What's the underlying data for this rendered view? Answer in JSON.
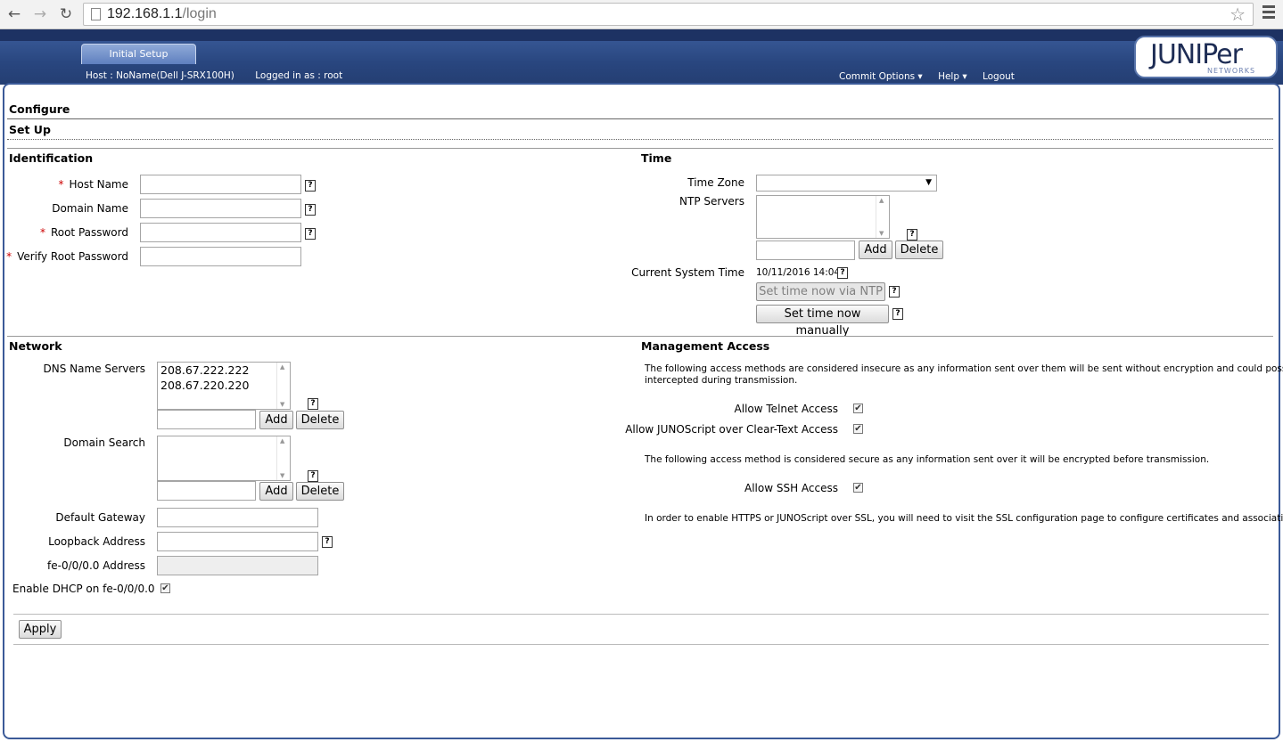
{
  "browser": {
    "url_host": "192.168.1.1",
    "url_path": "/login"
  },
  "header": {
    "tab_label": "Initial Setup",
    "host_info": "Host : NoName(Dell J-SRX100H)",
    "logged_in": "Logged in as : root",
    "menu": {
      "commit": "Commit Options ▾",
      "help": "Help ▾",
      "logout": "Logout"
    },
    "logo_word": "JUNIPer",
    "logo_sub": "NETWORKS"
  },
  "page": {
    "configure": "Configure",
    "setup": "Set Up"
  },
  "identification": {
    "heading": "Identification",
    "host_name": "Host Name",
    "domain_name": "Domain Name",
    "root_password": "Root Password",
    "verify_root_password": "Verify Root Password",
    "required_mark": "*"
  },
  "time": {
    "heading": "Time",
    "time_zone": "Time Zone",
    "ntp_servers": "NTP Servers",
    "add": "Add",
    "delete": "Delete",
    "current_system_time_label": "Current System Time",
    "current_system_time_value": "10/11/2016 14:04",
    "set_ntp": "Set time now via NTP",
    "set_manual": "Set time now manually"
  },
  "network": {
    "heading": "Network",
    "dns_label": "DNS Name Servers",
    "dns_servers": [
      "208.67.222.222",
      "208.67.220.220"
    ],
    "add": "Add",
    "delete": "Delete",
    "domain_search": "Domain Search",
    "default_gateway": "Default Gateway",
    "loopback_address": "Loopback Address",
    "fe_address": "fe-0/0/0.0 Address",
    "enable_dhcp": "Enable DHCP on fe-0/0/0.0"
  },
  "management": {
    "heading": "Management Access",
    "insecure_note": "The following access methods are considered insecure as any information sent over them will be sent without encryption and could possibly be",
    "insecure_note2": "intercepted during transmission.",
    "telnet": "Allow Telnet Access",
    "junoscript": "Allow JUNOScript over Clear-Text Access",
    "secure_note": "The following access method is considered secure as any information sent over it will be encrypted before transmission.",
    "ssh": "Allow SSH Access",
    "ssl_note": "In order to enable HTTPS or JUNOScript over SSL, you will need to visit the SSL configuration page to configure certificates and associations."
  },
  "help_mark": "?",
  "check_mark": "✔",
  "apply": "Apply"
}
